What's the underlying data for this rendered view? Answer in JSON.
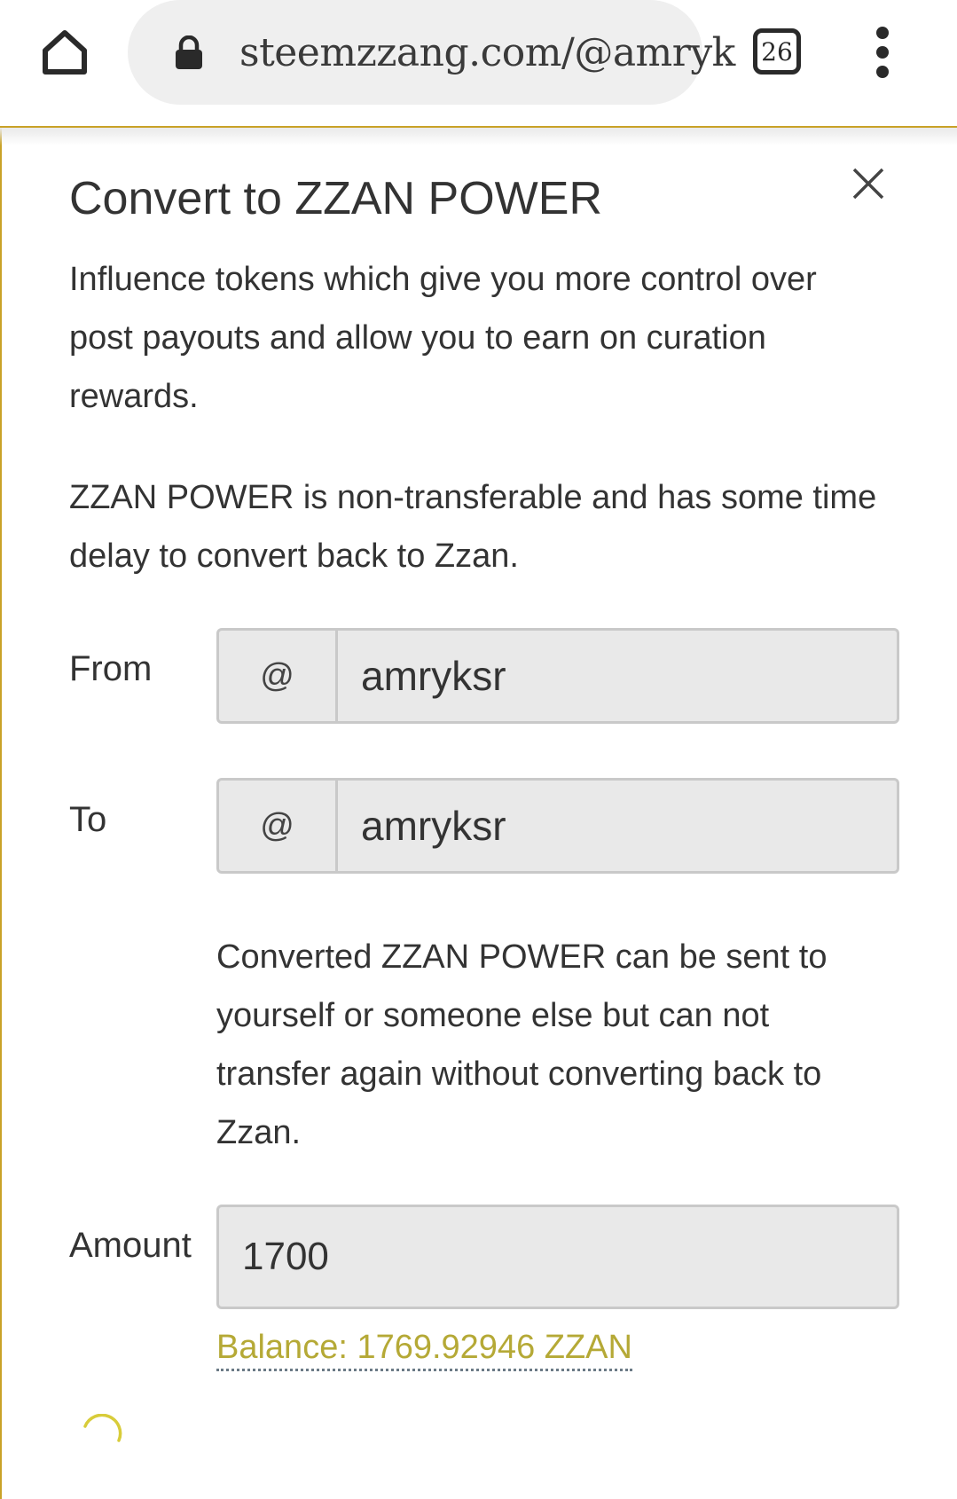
{
  "browser": {
    "url": "steemzzang.com/@amryk",
    "tab_count": "26",
    "icons": [
      "home-icon",
      "lock-icon",
      "tabs-icon",
      "more-vert-icon"
    ]
  },
  "modal": {
    "title": "Convert to ZZAN POWER",
    "description_1": "Influence tokens which give you more control over post payouts and allow you to earn on curation rewards.",
    "description_2": "ZZAN POWER is non-transferable and has some time delay to convert back to Zzan.",
    "close_icon": "close-icon",
    "from": {
      "label": "From",
      "prefix": "@",
      "value": "amryksr"
    },
    "to": {
      "label": "To",
      "prefix": "@",
      "value": "amryksr"
    },
    "help_text": "Converted ZZAN POWER can be sent to yourself or someone else but can not transfer again without converting back to Zzan.",
    "amount": {
      "label": "Amount",
      "value": "1700"
    },
    "balance": "Balance: 1769.92946 ZZAN",
    "accent_color": "#c9a227",
    "balance_color": "#b5a936"
  }
}
